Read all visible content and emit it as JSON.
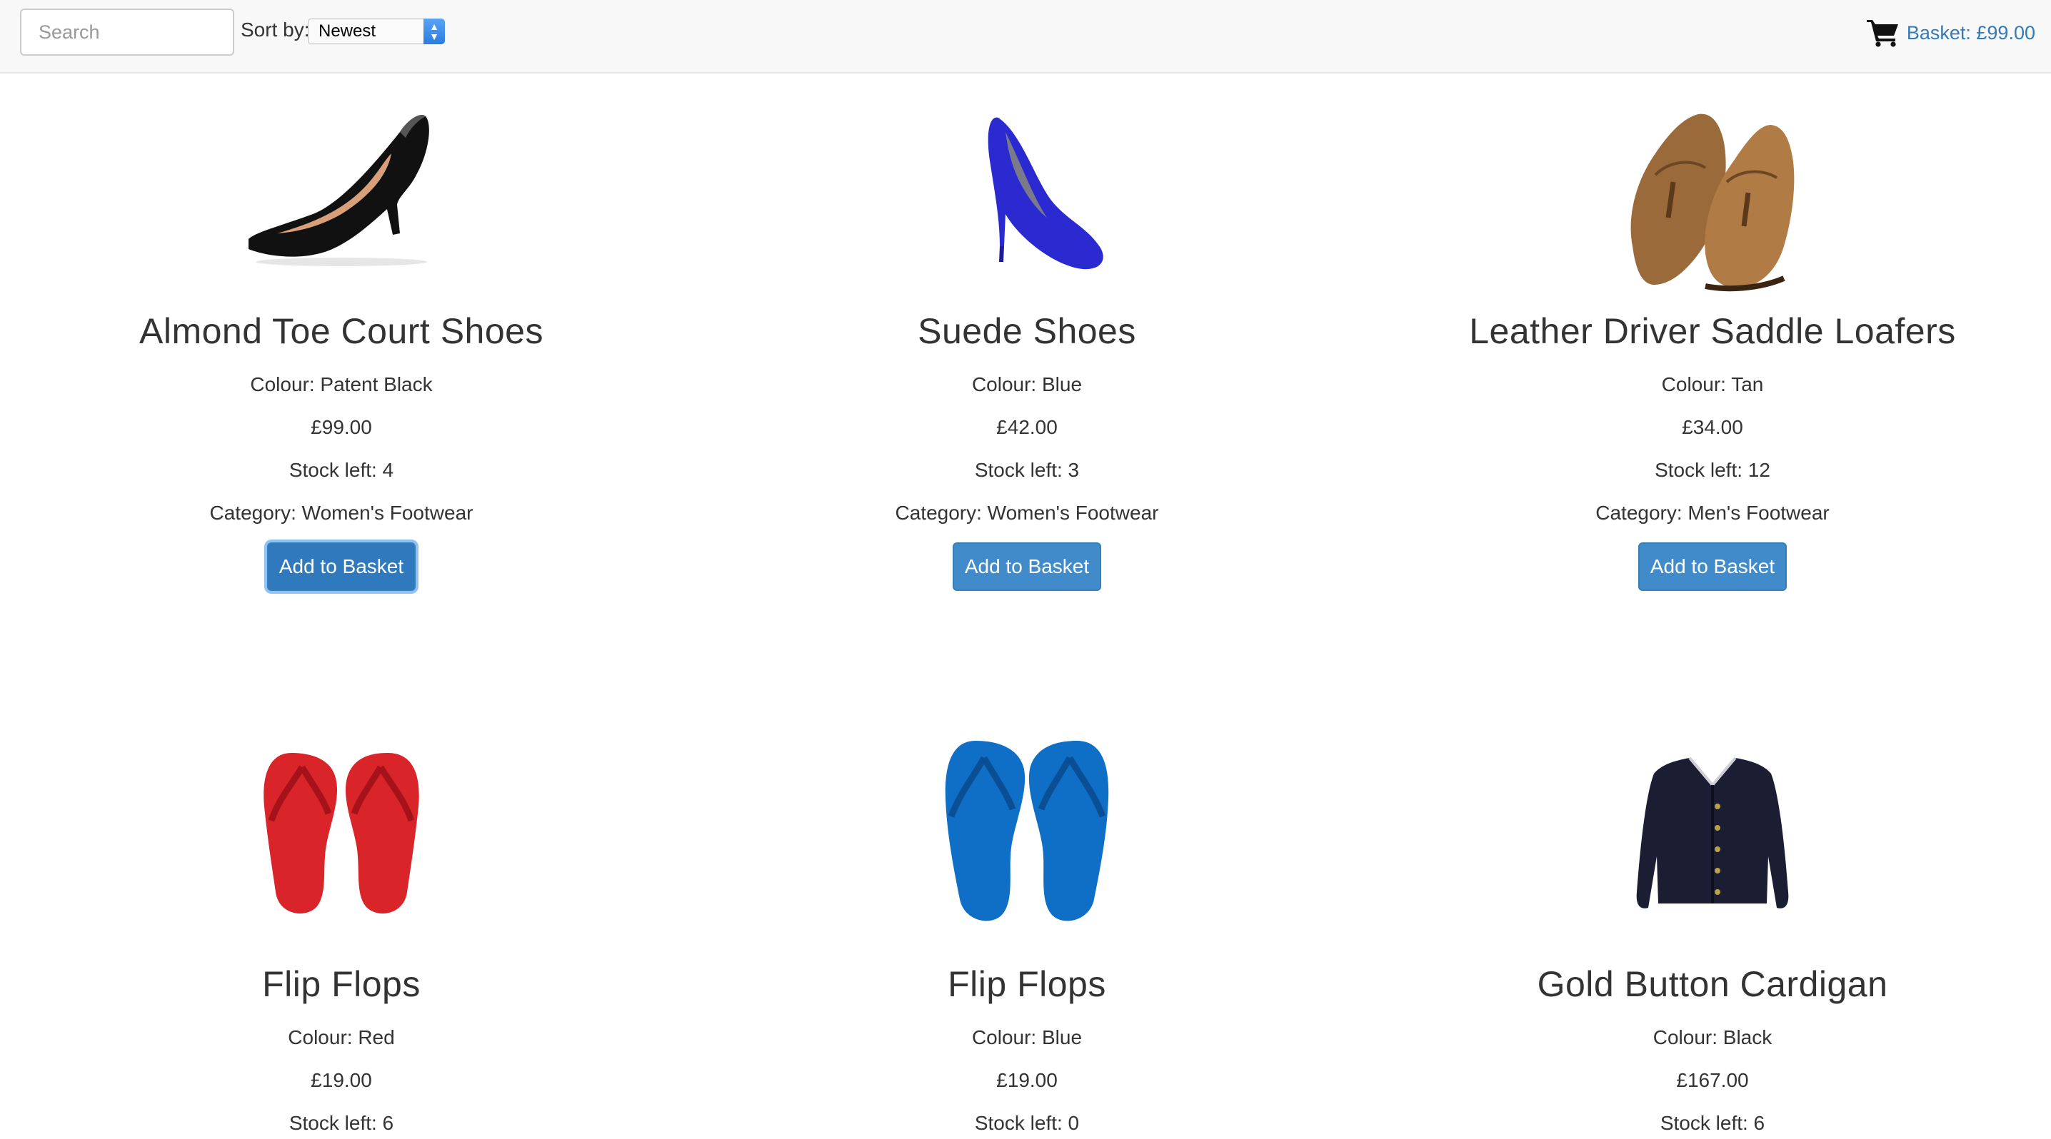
{
  "topbar": {
    "search_placeholder": "Search",
    "sort_label": "Sort by:",
    "sort_selected": "Newest",
    "basket_label": "Basket: £99.00",
    "accent_color": "#337ab7"
  },
  "products": [
    {
      "name": "Almond Toe Court Shoes",
      "colour": "Colour: Patent Black",
      "price": "£99.00",
      "stock": "Stock left: 4",
      "category": "Category: Women's Footwear",
      "button": "Add to Basket",
      "image_icon": "black-court-shoe-image"
    },
    {
      "name": "Suede Shoes",
      "colour": "Colour: Blue",
      "price": "£42.00",
      "stock": "Stock left: 3",
      "category": "Category: Women's Footwear",
      "button": "Add to Basket",
      "image_icon": "blue-suede-heel-image"
    },
    {
      "name": "Leather Driver Saddle Loafers",
      "colour": "Colour: Tan",
      "price": "£34.00",
      "stock": "Stock left: 12",
      "category": "Category: Men's Footwear",
      "button": "Add to Basket",
      "image_icon": "tan-loafers-image"
    },
    {
      "name": "Flip Flops",
      "colour": "Colour: Red",
      "price": "£19.00",
      "stock": "Stock left: 6",
      "image_icon": "red-flip-flops-image"
    },
    {
      "name": "Flip Flops",
      "colour": "Colour: Blue",
      "price": "£19.00",
      "stock": "Stock left: 0",
      "image_icon": "blue-flip-flops-image"
    },
    {
      "name": "Gold Button Cardigan",
      "colour": "Colour: Black",
      "price": "£167.00",
      "stock": "Stock left: 6",
      "image_icon": "black-cardigan-image"
    }
  ]
}
